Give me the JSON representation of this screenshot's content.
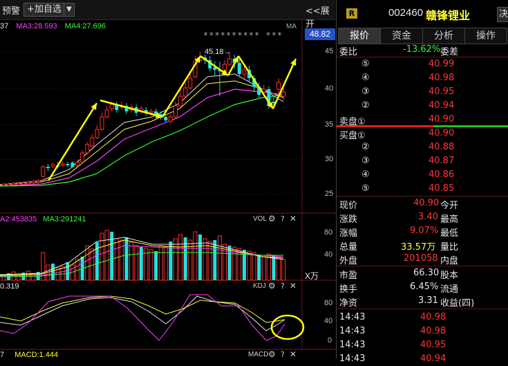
{
  "toolbar": {
    "alert_label": "预警",
    "add_watch_label": "+加自选",
    "expand_label": "<<展开"
  },
  "price_panel": {
    "ma_labels": [
      {
        "text": "37",
        "color": "#e6e6e6"
      },
      {
        "text": "MA3:28.593",
        "color": "#ff40ff"
      },
      {
        "text": "MA4:27.696",
        "color": "#33ff33"
      }
    ],
    "stars": "********** ***",
    "ma_tag": "MA",
    "peak_label": "45.18→",
    "current_price_tag": "48.82",
    "y_axis": [
      "45",
      "40",
      "35",
      "30",
      "25"
    ]
  },
  "volume_panel": {
    "labels": [
      {
        "text": "A2:453835",
        "color": "#ff40ff"
      },
      {
        "text": "MA3:291241",
        "color": "#33ff33"
      }
    ],
    "tag": "VOL",
    "y_axis": [
      "80",
      "40"
    ],
    "unit": "X万"
  },
  "kdj_panel": {
    "label": "0.319",
    "tag": "KDJ",
    "y_axis": [
      "80",
      "40",
      "0"
    ]
  },
  "macd_panel": {
    "labels": [
      {
        "text": "7",
        "color": "#e6e6e6"
      },
      {
        "text": "MACD:1.444",
        "color": "#ffff3a"
      }
    ],
    "tag": "MACD"
  },
  "quote": {
    "badge": "R",
    "code": "002460",
    "name": "赣锋锂业",
    "corner": "决",
    "tabs": [
      "报价",
      "资金",
      "分析",
      "操作"
    ],
    "ratio_label": "委比",
    "ratio_value": "-13.62%",
    "diff_label": "委差",
    "sell": [
      {
        "level": "⑤",
        "price": "40.99"
      },
      {
        "level": "④",
        "price": "40.98"
      },
      {
        "level": "③",
        "price": "40.95"
      },
      {
        "level": "②",
        "price": "40.94"
      },
      {
        "level": "卖盘①",
        "price": "40.90"
      }
    ],
    "buy": [
      {
        "level": "买盘①",
        "price": "40.90"
      },
      {
        "level": "②",
        "price": "40.88"
      },
      {
        "level": "③",
        "price": "40.87"
      },
      {
        "level": "④",
        "price": "40.86"
      },
      {
        "level": "⑤",
        "price": "40.85"
      }
    ],
    "stats": [
      {
        "l1": "现价",
        "v1": "40.90",
        "c1": "#ff3838",
        "l2": "今开",
        "v2": ""
      },
      {
        "l1": "涨跌",
        "v1": "3.40",
        "c1": "#ff3838",
        "l2": "最高",
        "v2": ""
      },
      {
        "l1": "涨幅",
        "v1": "9.07%",
        "c1": "#ff3838",
        "l2": "最低",
        "v2": ""
      },
      {
        "l1": "总量",
        "v1": "33.57万",
        "c1": "#ffff3a",
        "l2": "量比",
        "v2": ""
      },
      {
        "l1": "外盘",
        "v1": "201058",
        "c1": "#ff3838",
        "l2": "内盘",
        "v2": ""
      }
    ],
    "stats2": [
      {
        "l1": "市盈",
        "v1": "66.30",
        "c1": "#e6e6e6",
        "l2": "股本"
      },
      {
        "l1": "换手",
        "v1": "6.45%",
        "c1": "#e6e6e6",
        "l2": "流通"
      },
      {
        "l1": "净资",
        "v1": "3.31",
        "c1": "#e6e6e6",
        "l2": "收益(四)"
      }
    ],
    "ticks": [
      {
        "time": "14:43",
        "price": "40.98"
      },
      {
        "time": "14:43",
        "price": "40.98"
      },
      {
        "time": "14:43",
        "price": "40.95"
      },
      {
        "time": "14:43",
        "price": "40.94"
      }
    ]
  }
}
